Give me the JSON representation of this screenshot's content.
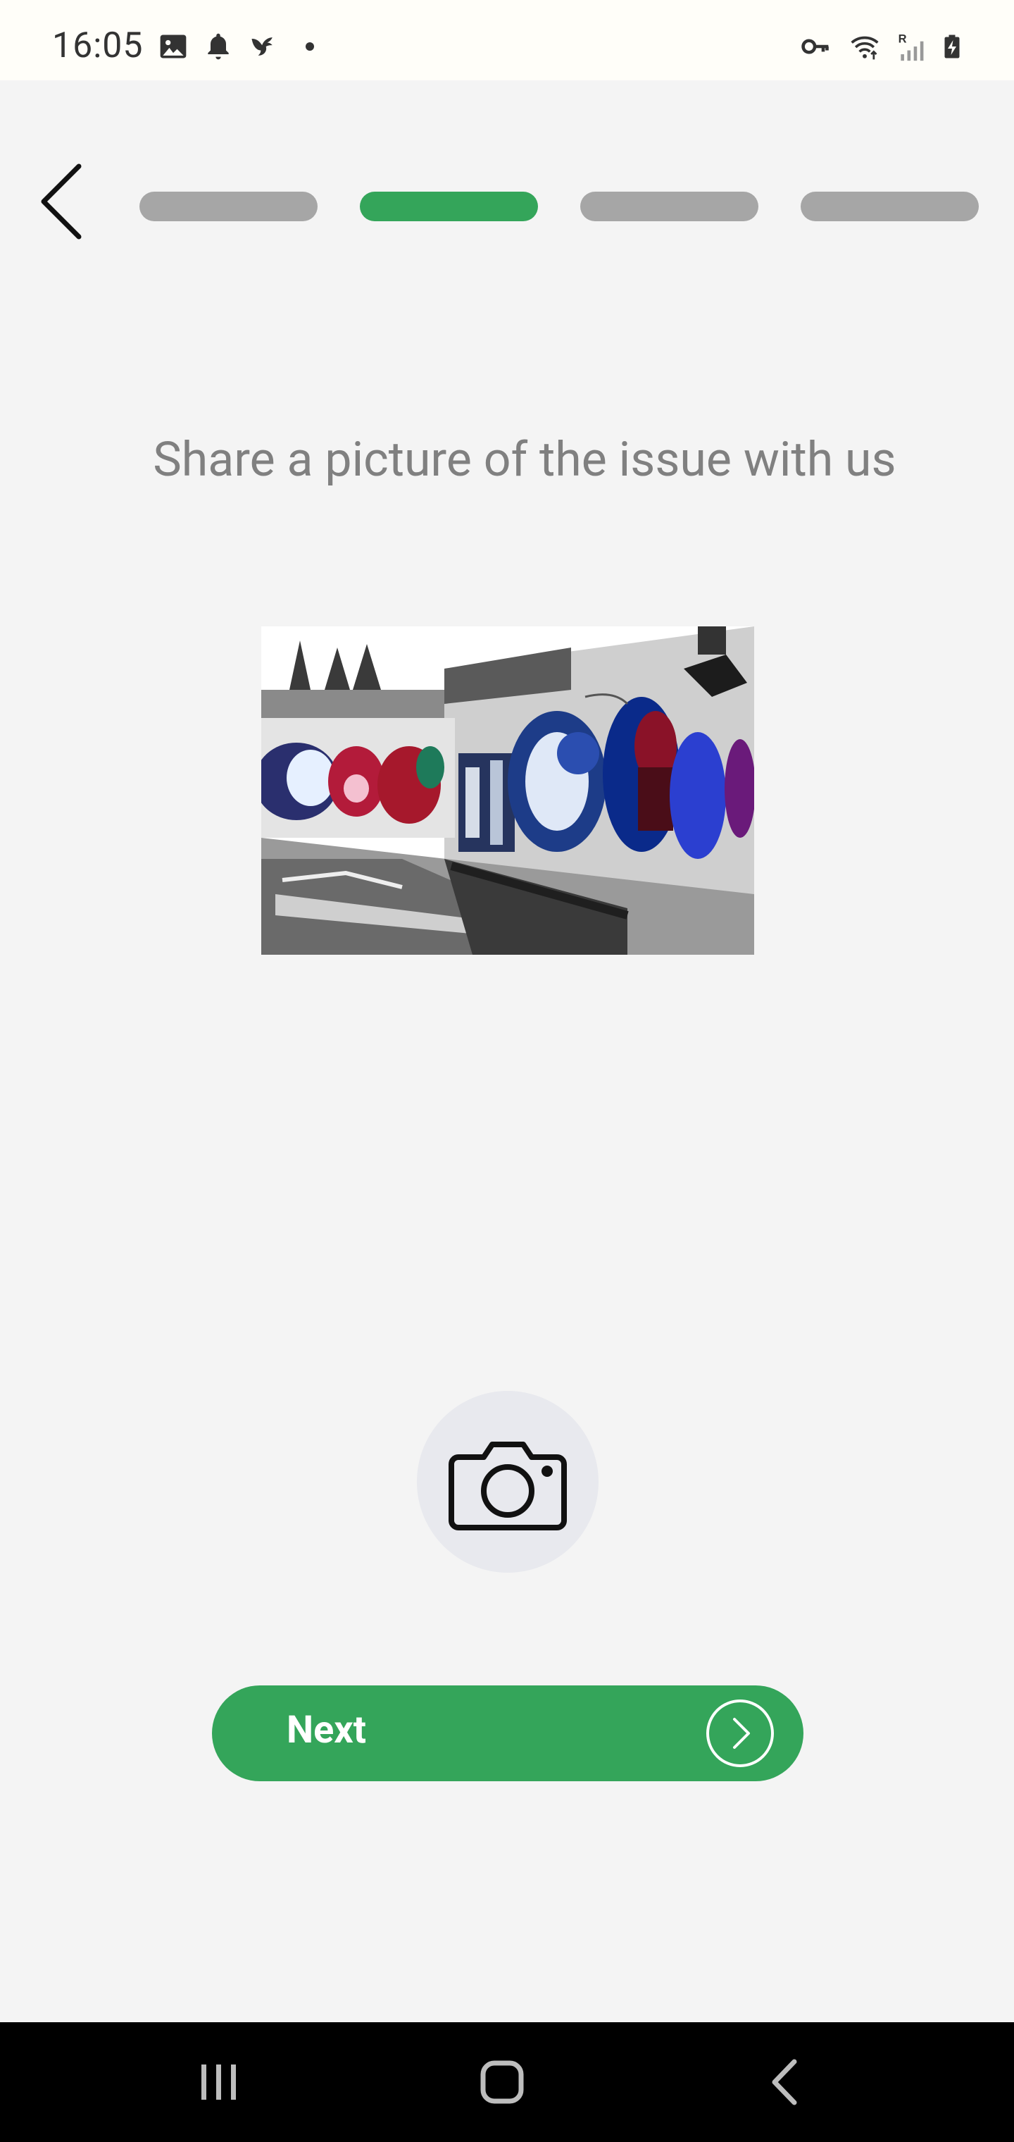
{
  "status_bar": {
    "time": "16:05",
    "left_icons": [
      "image-icon",
      "notification-bell-icon",
      "bird-icon",
      "dot-icon"
    ],
    "right_icons": [
      "vpn-key-icon",
      "wifi-icon",
      "signal-roaming-icon",
      "battery-charging-icon"
    ],
    "roaming_letter": "R"
  },
  "header": {
    "back_icon": "chevron-left-icon",
    "steps": [
      {
        "state": "inactive"
      },
      {
        "state": "active"
      },
      {
        "state": "inactive"
      },
      {
        "state": "inactive"
      }
    ],
    "current_step": 2,
    "total_steps": 4
  },
  "main": {
    "prompt": "Share a picture of the issue with us",
    "photo_icon": "graffiti-wall-photo",
    "camera_icon": "camera-icon"
  },
  "footer": {
    "next_label": "Next",
    "next_icon": "chevron-right-circle-icon"
  },
  "nav_bar": {
    "recent_icon": "recent-apps-icon",
    "home_icon": "home-icon",
    "back_icon": "back-icon"
  },
  "colors": {
    "accent": "#34a55a",
    "inactive": "#a6a6a6",
    "background": "#f4f4f4",
    "prompt_text": "#808080"
  }
}
